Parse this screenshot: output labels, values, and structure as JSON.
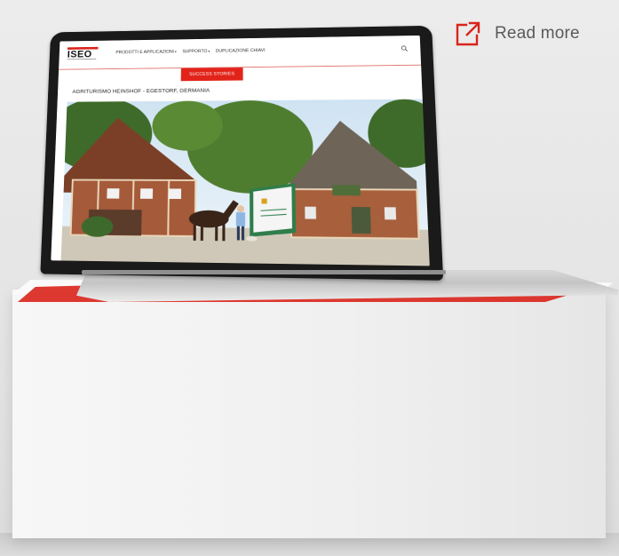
{
  "read_more": {
    "label": "Read more",
    "icon": "external-link-icon",
    "color": "#d9241b"
  },
  "website": {
    "logo_text": "ISEO",
    "brand_color": "#e2231a",
    "nav": [
      {
        "label": "PRODOTTI E APPLICAZIONI",
        "has_dropdown": true
      },
      {
        "label": "SUPPORTO",
        "has_dropdown": true
      },
      {
        "label": "DUPLICAZIONE CHIAVI",
        "has_dropdown": false
      }
    ],
    "search_icon": "search-icon",
    "section_button": "SUCCESS STORIES",
    "story_title": "AGRITURISMO HEINSHOF - EGESTORF, GERMANIA"
  },
  "photo": {
    "description_icon": "farmhouse-photo"
  }
}
